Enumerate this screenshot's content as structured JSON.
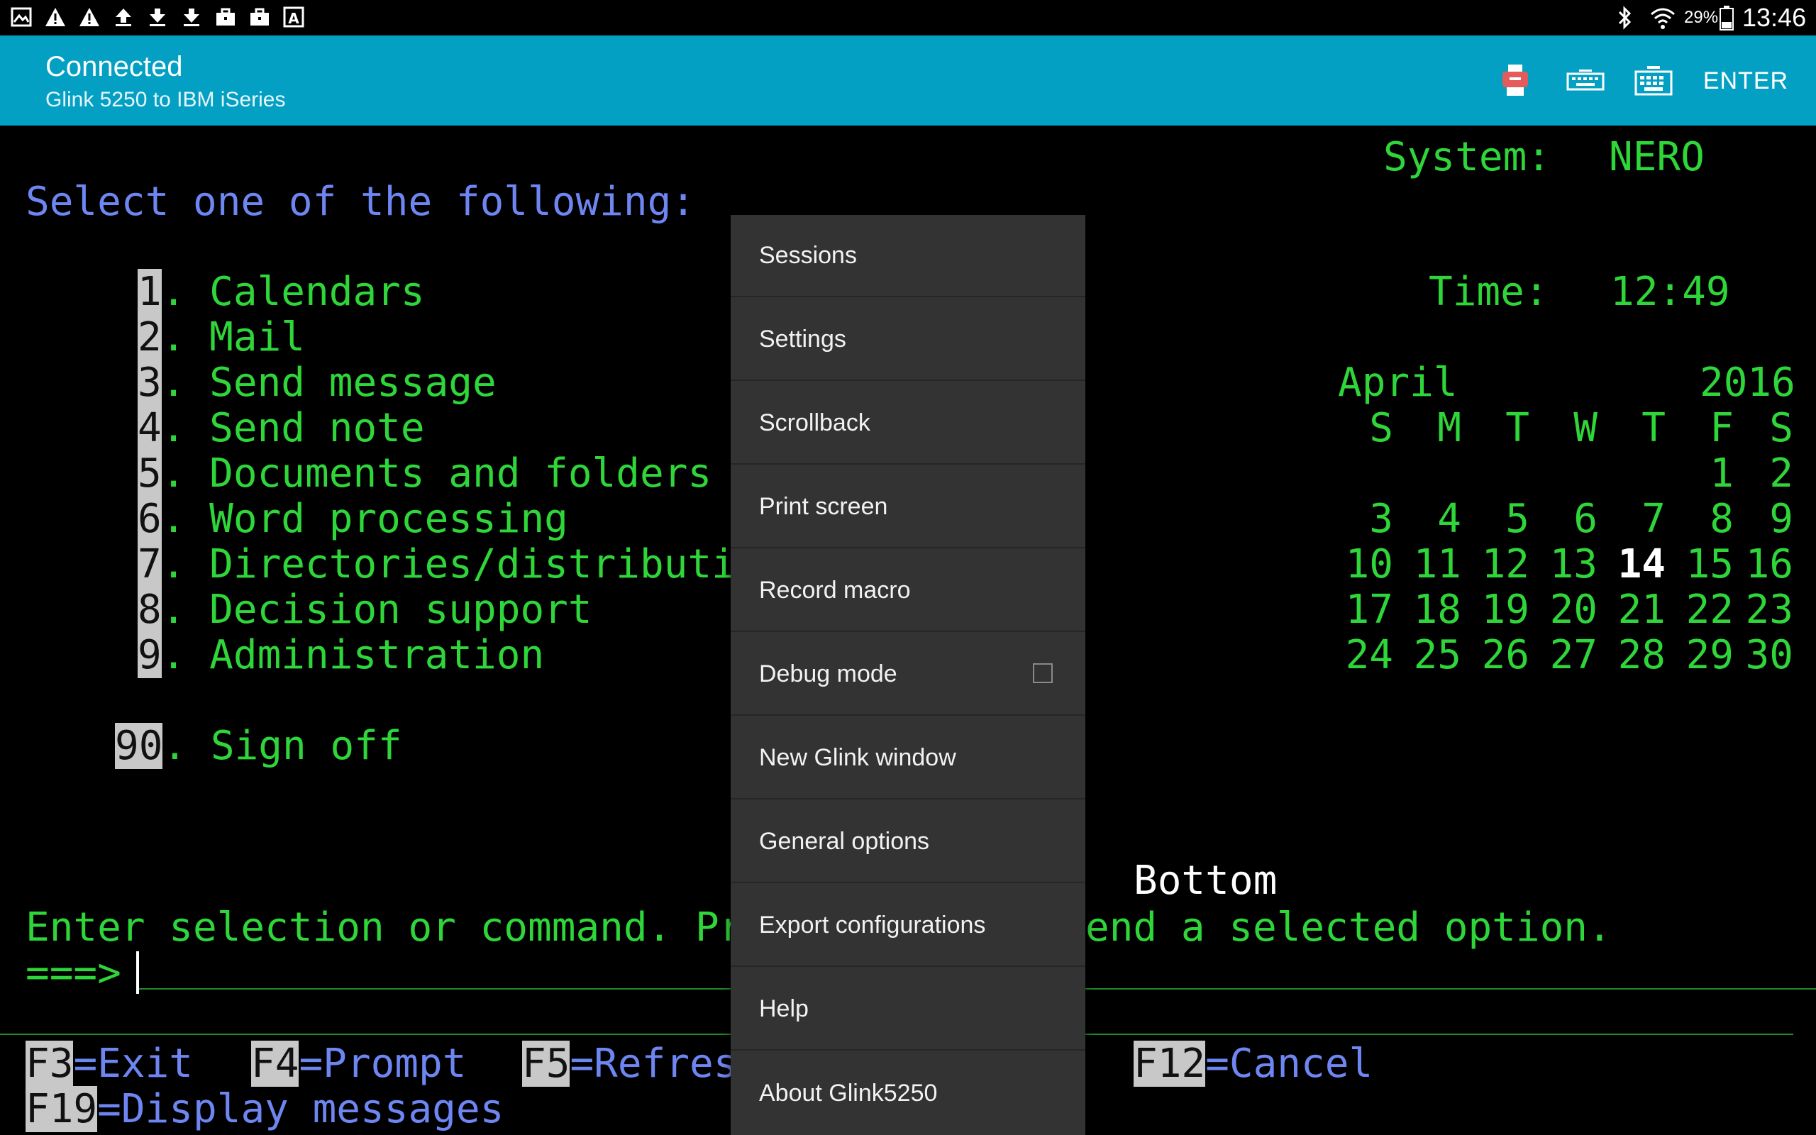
{
  "status_bar": {
    "icons": [
      "image-icon",
      "warning-icon",
      "warning-icon",
      "upload-icon",
      "download-icon",
      "download-icon",
      "briefcase-icon",
      "briefcase-icon",
      "font-icon"
    ],
    "battery": "29%",
    "time": "13:46"
  },
  "app_bar": {
    "title": "Connected",
    "subtitle": "Glink 5250 to IBM iSeries",
    "enter_label": "ENTER"
  },
  "terminal": {
    "system_label": "System:",
    "system_value": "NERO",
    "heading": "Select one of the following:",
    "time_label": "Time:",
    "time_value": "12:49",
    "options": [
      {
        "num": "1",
        "text": ". Calendars"
      },
      {
        "num": "2",
        "text": ". Mail"
      },
      {
        "num": "3",
        "text": ". Send message"
      },
      {
        "num": "4",
        "text": ". Send note"
      },
      {
        "num": "5",
        "text": ". Documents and folders"
      },
      {
        "num": "6",
        "text": ". Word processing"
      },
      {
        "num": "7",
        "text": ". Directories/distributio"
      },
      {
        "num": "8",
        "text": ". Decision support"
      },
      {
        "num": "9",
        "text": ". Administration"
      }
    ],
    "signoff_num": "90",
    "signoff_text": ". Sign off",
    "bottom_label": "Bottom",
    "prompt_left": "Enter selection or command. Pre",
    "prompt_right": "end a selected option.",
    "command_prompt": "===>",
    "fkeys": [
      {
        "key": "F3",
        "label": "=Exit"
      },
      {
        "key": "F4",
        "label": "=Prompt"
      },
      {
        "key": "F5",
        "label": "=Refres"
      },
      {
        "key": "F12",
        "label": "=Cancel"
      },
      {
        "key": "F19",
        "label": "=Display messages"
      }
    ],
    "calendar": {
      "month": "April",
      "year": "2016",
      "weekdays": [
        "S",
        "M",
        "T",
        "W",
        "T",
        "F",
        "S"
      ],
      "weeks": [
        [
          "",
          "",
          "",
          "",
          "",
          "1",
          "2"
        ],
        [
          "3",
          "4",
          "5",
          "6",
          "7",
          "8",
          "9"
        ],
        [
          "10",
          "11",
          "12",
          "13",
          "14",
          "15",
          "16"
        ],
        [
          "17",
          "18",
          "19",
          "20",
          "21",
          "22",
          "23"
        ],
        [
          "24",
          "25",
          "26",
          "27",
          "28",
          "29",
          "30"
        ]
      ],
      "today": "14"
    }
  },
  "menu": {
    "items": [
      {
        "label": "Sessions"
      },
      {
        "label": "Settings"
      },
      {
        "label": "Scrollback"
      },
      {
        "label": "Print screen"
      },
      {
        "label": "Record macro"
      },
      {
        "label": "Debug mode",
        "checkbox": true,
        "checked": false
      },
      {
        "label": "New Glink window"
      },
      {
        "label": "General options"
      },
      {
        "label": "Export configurations"
      },
      {
        "label": "Help"
      },
      {
        "label": "About Glink5250"
      }
    ]
  }
}
